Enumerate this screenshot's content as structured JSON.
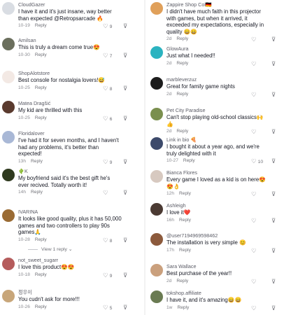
{
  "reply_label": "Reply",
  "left": [
    {
      "name": "CloudGazer",
      "text": "I have it and it's just insane, way better than expected @Retropsarcade 🔥",
      "time": "10-19",
      "likes": "9",
      "avatar": "#d9dde3"
    },
    {
      "name": "Amilsan",
      "text": "This is truly a dream come true😍",
      "time": "10-30",
      "likes": "7",
      "avatar": "#6b6f5d"
    },
    {
      "name": "ShopAlotstore",
      "text": "Best console for nostalgia lovers!😅",
      "time": "10-25",
      "likes": "8",
      "avatar": "#f3e9e4"
    },
    {
      "name": "Matea Dragšić",
      "text": "My kid are thrilled with this",
      "time": "10-25",
      "likes": "6",
      "avatar": "#5a3a2e"
    },
    {
      "name": "Floridalover",
      "text": "I've had it for seven months, and I haven't had any problems, it's better than expected!",
      "time": "13h",
      "likes": "9",
      "avatar": "#a9b8d6"
    },
    {
      "name": "🌵K",
      "text": "My boyfriend said it's the best gift he's ever recived. Totally worth it!",
      "time": "14h",
      "likes": "",
      "avatar": "#2f3a1f"
    },
    {
      "name": "IVARINA",
      "text": "It looks like good quality, plus it has 50,000 games and two controllers to play 90s games🙏",
      "time": "10-28",
      "likes": "8",
      "avatar": "#9a6b34",
      "view_replies": "View 1 reply ⌄"
    },
    {
      "name": "not_sweet_sugarr",
      "text": "I love this product😍😍",
      "time": "10-18",
      "likes": "9",
      "avatar": "#b55c5c"
    },
    {
      "name": "정우이",
      "text": "You cudn't ask for more!!!",
      "time": "10-26",
      "likes": "5",
      "avatar": "#c8a67a"
    }
  ],
  "right": [
    {
      "name": "Zappire Shop Col🇩🇪",
      "text": "I didn't have much faith in this projector with games, but when it arrived, it exceeded my expectations, especially in quality 😄😄",
      "time": "2d",
      "likes": "",
      "avatar": "#e0a05a"
    },
    {
      "name": "GlowAura",
      "text": "Just what I needed!!",
      "time": "2d",
      "likes": "",
      "avatar": "#2bb3c0"
    },
    {
      "name": "marbleverzuz",
      "text": "Great for family game nights",
      "time": "2d",
      "likes": "",
      "avatar": "#1c1c1c"
    },
    {
      "name": "Pet City Paradise",
      "text": "Can't stop playing old-school classics🙌👍",
      "time": "2d",
      "likes": "",
      "avatar": "#7a8f4e"
    },
    {
      "name": "Link in bio 🍕",
      "text": "I bought it about a year ago, and we're truly delighted with it",
      "time": "10-27",
      "likes": "10",
      "avatar": "#3d4a6b"
    },
    {
      "name": "Bianca Flores",
      "text": "Every game I loved as a kid is on here😍😍👌",
      "time": "12h",
      "likes": "",
      "avatar": "#d7c9c0"
    },
    {
      "name": "Ashleigh",
      "text": "I love it❤️",
      "time": "16h",
      "likes": "",
      "avatar": "#4b3a33"
    },
    {
      "name": "@user7194969598462",
      "text": "The installation is very simple 😊",
      "time": "17h",
      "likes": "",
      "avatar": "#8c5a3c"
    },
    {
      "name": "Sara Wallace",
      "text": "Best purchase of the year!!",
      "time": "2d",
      "likes": "",
      "avatar": "#caa07d"
    },
    {
      "name": "tokshop.affiliate",
      "text": "I have it, and it's amazing😄😄",
      "time": "1w",
      "likes": "",
      "avatar": "#6a7b52"
    }
  ]
}
